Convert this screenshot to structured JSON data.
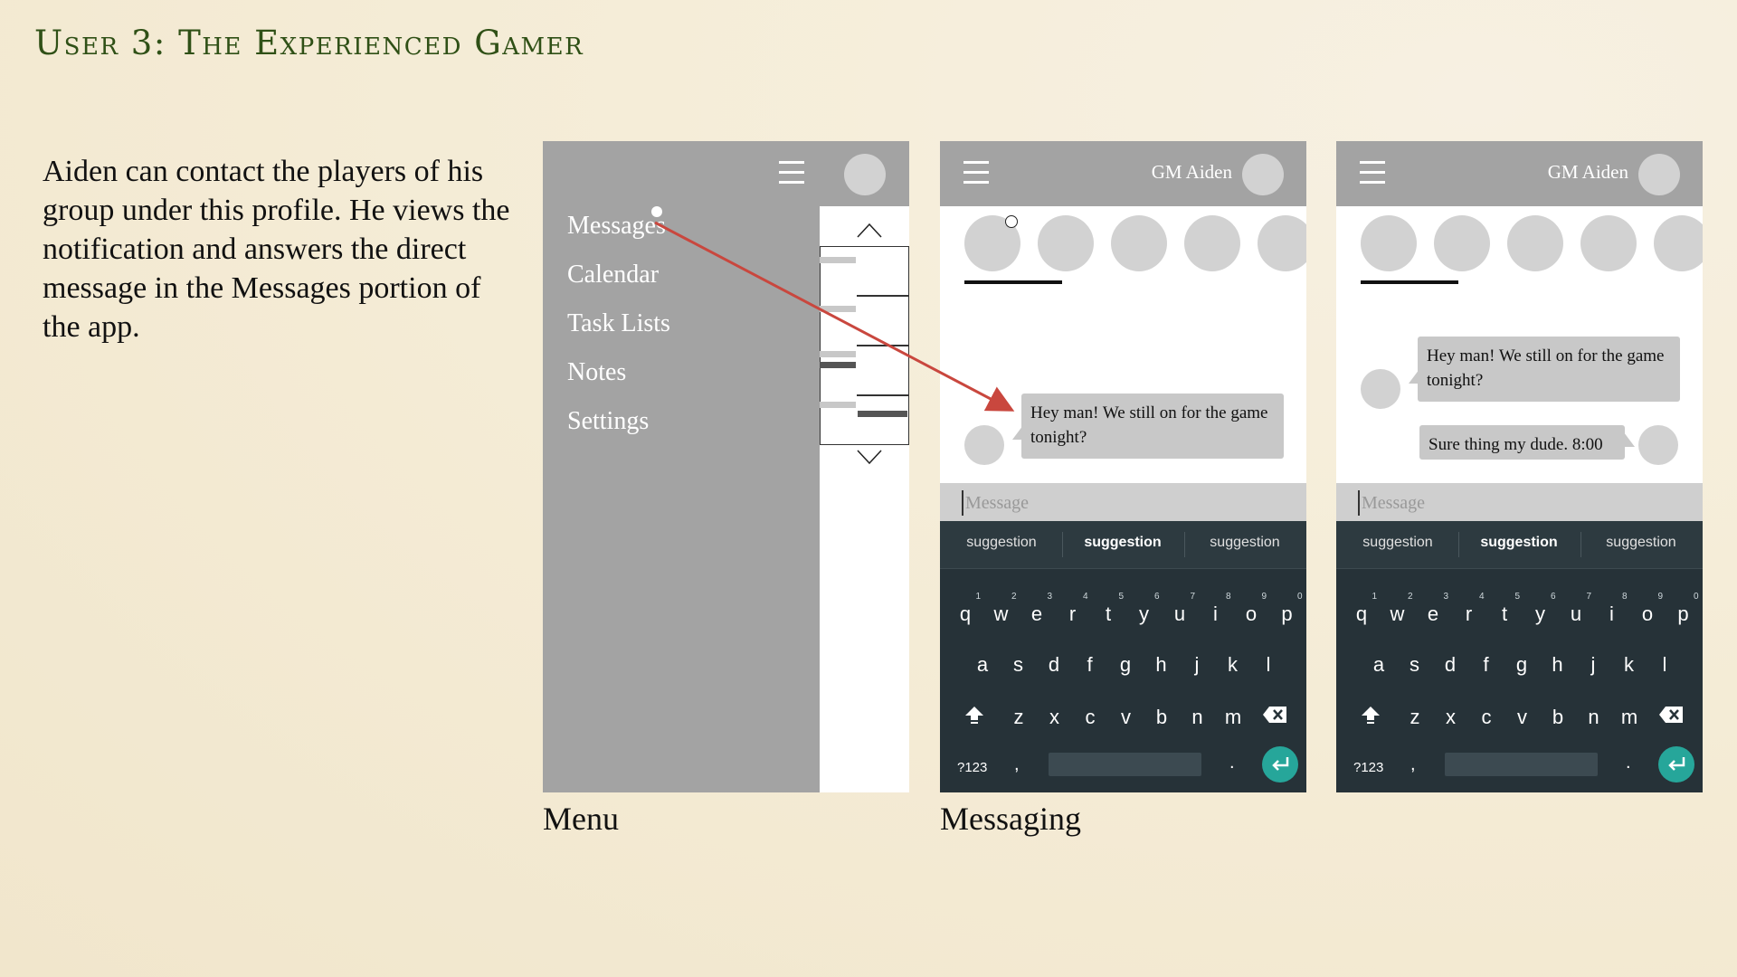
{
  "slide": {
    "title": "User 3: The Experienced Gamer",
    "description": "Aiden can contact the players of his group under this profile. He views the notification and answers the direct message in the Messages portion of the app."
  },
  "captions": {
    "menu": "Menu",
    "messaging": "Messaging"
  },
  "menu_screen": {
    "items": [
      "Messages",
      "Calendar",
      "Task Lists",
      "Notes",
      "Settings"
    ]
  },
  "messaging": {
    "header_name": "GM Aiden",
    "incoming_message": "Hey man! We still on for the game tonight?",
    "reply_message": "Sure thing my dude. 8:00",
    "input_placeholder": "Message"
  },
  "keyboard": {
    "suggestions": [
      "suggestion",
      "suggestion",
      "suggestion"
    ],
    "row1": [
      "q",
      "w",
      "e",
      "r",
      "t",
      "y",
      "u",
      "i",
      "o",
      "p"
    ],
    "row1_numbers": [
      "1",
      "2",
      "3",
      "4",
      "5",
      "6",
      "7",
      "8",
      "9",
      "0"
    ],
    "row2": [
      "a",
      "s",
      "d",
      "f",
      "g",
      "h",
      "j",
      "k",
      "l"
    ],
    "row3": [
      "z",
      "x",
      "c",
      "v",
      "b",
      "n",
      "m"
    ],
    "symbols_key": "?123",
    "comma_key": ",",
    "period_key": "."
  },
  "colors": {
    "title_green": "#2f5016",
    "wire_gray": "#a3a3a3",
    "annotation_arrow": "#c9473e",
    "keyboard_bg": "#263238",
    "enter_teal": "#26a69a"
  }
}
